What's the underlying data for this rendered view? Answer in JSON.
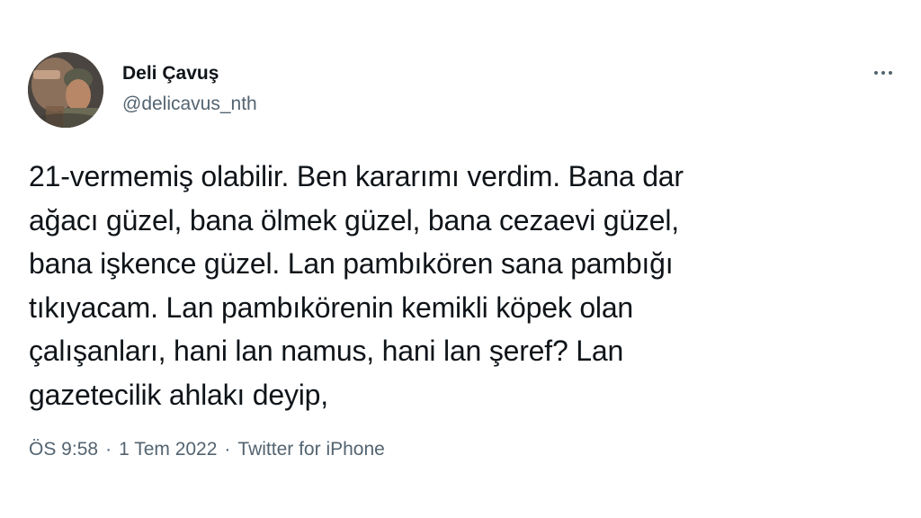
{
  "author": {
    "display_name": "Deli Çavuş",
    "handle": "@delicavus_nth"
  },
  "tweet": {
    "text": "21-vermemiş olabilir. Ben kararımı verdim. Bana dar\nağacı güzel, bana ölmek güzel, bana cezaevi güzel,\nbana işkence güzel. Lan pambıkören sana pambığı\ntıkıyacam. Lan pambıkörenin kemikli köpek olan\nçalışanları, hani lan namus, hani lan şeref? Lan\ngazetecilik ahlakı deyip,"
  },
  "meta": {
    "time": "ÖS 9:58",
    "separator1": "·",
    "date": "1 Tem 2022",
    "separator2": "·",
    "source": "Twitter for iPhone"
  },
  "icons": {
    "more": "more-horizontal-icon"
  },
  "colors": {
    "primary_text": "#0f1419",
    "secondary_text": "#536471",
    "background": "#ffffff"
  }
}
